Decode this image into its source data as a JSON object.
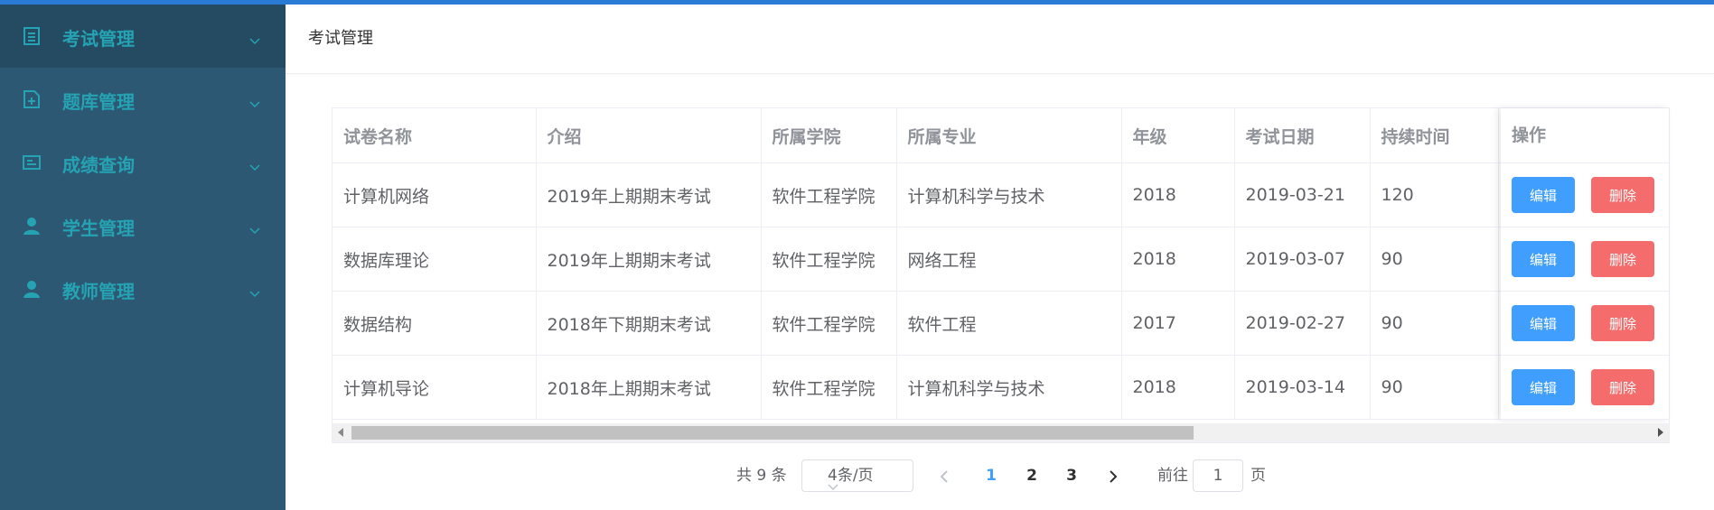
{
  "colors": {
    "accent": "#2a7bd6",
    "sidebar_bg": "#2d5873",
    "menu_text": "#25a3b3",
    "edit_btn": "#409eff",
    "delete_btn": "#f56c6c"
  },
  "sidebar": {
    "items": [
      {
        "label": "考试管理",
        "icon": "document-list-icon"
      },
      {
        "label": "题库管理",
        "icon": "file-icon"
      },
      {
        "label": "成绩查询",
        "icon": "card-icon"
      },
      {
        "label": "学生管理",
        "icon": "student-user-icon"
      },
      {
        "label": "教师管理",
        "icon": "teacher-user-icon"
      }
    ]
  },
  "header": {
    "title": "考试管理"
  },
  "table": {
    "columns": [
      "试卷名称",
      "介绍",
      "所属学院",
      "所属专业",
      "年级",
      "考试日期",
      "持续时间",
      "操作"
    ],
    "rows": [
      [
        "计算机网络",
        "2019年上期期末考试",
        "软件工程学院",
        "计算机科学与技术",
        "2018",
        "2019-03-21",
        "120"
      ],
      [
        "数据库理论",
        "2019年上期期末考试",
        "软件工程学院",
        "网络工程",
        "2018",
        "2019-03-07",
        "90"
      ],
      [
        "数据结构",
        "2018年下期期末考试",
        "软件工程学院",
        "软件工程",
        "2017",
        "2019-02-27",
        "90"
      ],
      [
        "计算机导论",
        "2018年上期期末考试",
        "软件工程学院",
        "计算机科学与技术",
        "2018",
        "2019-03-14",
        "90"
      ]
    ],
    "edit_label": "编辑",
    "delete_label": "删除"
  },
  "pagination": {
    "total_text": "共 9 条",
    "page_size": "4条/页",
    "pages": [
      "1",
      "2",
      "3"
    ],
    "current_page": "1",
    "goto_label": "前往",
    "goto_value": "1",
    "page_unit": "页"
  }
}
